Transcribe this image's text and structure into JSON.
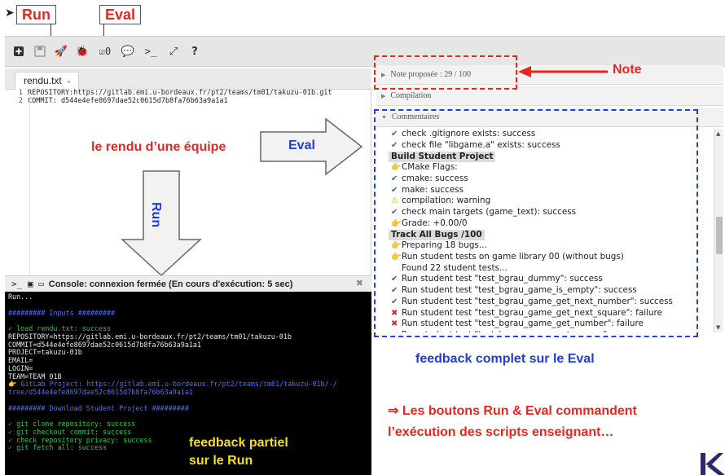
{
  "callouts": {
    "run": "Run",
    "eval": "Eval"
  },
  "toolbar": {
    "icons": [
      "new-file-icon",
      "save-icon",
      "run-rocket-icon",
      "bug-icon",
      "eval-checkbox-icon",
      "comment-icon",
      "terminal-icon",
      "fullscreen-icon",
      "help-icon"
    ],
    "eval_count": "0"
  },
  "editor": {
    "tab_label": "rendu.txt",
    "lines": [
      {
        "num": "1",
        "text": "REPOSITORY:https://gitlab.emi.u-bordeaux.fr/pt2/teams/tm01/takuzu-01b.git"
      },
      {
        "num": "2",
        "text": "COMMIT:  d544e4efe8697dae52c0615d7b8fa76b63a9a1a1"
      }
    ]
  },
  "annotations": {
    "team_render": "le rendu d’une équipe",
    "eval_arrow": "Eval",
    "run_arrow": "Run",
    "note": "Note",
    "feedback_full": "feedback complet sur le Eval",
    "buttons_line1": "⇒ Les boutons Run & Eval commandent",
    "buttons_line2": "l’exécution des scripts enseignant…",
    "feedback_partial_1": "feedback partiel",
    "feedback_partial_2": "sur le Run"
  },
  "panel": {
    "note_label": "Note proposée : 29 / 100",
    "compilation_label": "Compilation",
    "comments_label": "Commentaires",
    "comments": [
      {
        "icon": "check",
        "text": "check .gitignore exists: success"
      },
      {
        "icon": "check",
        "text": "check file \"libgame.a\" exists: success"
      },
      {
        "icon": "section",
        "text": "Build Student Project"
      },
      {
        "icon": "hand",
        "text": "CMake Flags:"
      },
      {
        "icon": "check",
        "text": "cmake: success"
      },
      {
        "icon": "check",
        "text": "make: success"
      },
      {
        "icon": "warn",
        "text": "compilation: warning"
      },
      {
        "icon": "check",
        "text": "check main targets (game_text): success"
      },
      {
        "icon": "hand",
        "text": "Grade: +0.00/0"
      },
      {
        "icon": "section",
        "text": "Track All Bugs /100"
      },
      {
        "icon": "hand",
        "text": "Preparing 18 bugs..."
      },
      {
        "icon": "hand",
        "text": "Run student tests on game library 00 (without bugs)"
      },
      {
        "icon": "none",
        "text": "Found 22 student tests..."
      },
      {
        "icon": "check",
        "text": "Run student test \"test_bgrau_dummy\": success"
      },
      {
        "icon": "check",
        "text": "Run student test \"test_bgrau_game_is_empty\": success"
      },
      {
        "icon": "check",
        "text": "Run student test \"test_bgrau_game_get_next_number\": success"
      },
      {
        "icon": "fail",
        "text": "Run student test \"test_bgrau_game_get_next_square\": failure"
      },
      {
        "icon": "fail",
        "text": "Run student test \"test_bgrau_game_get_number\": failure"
      },
      {
        "icon": "check",
        "text": "Run student test \"test_bgrau_game_get_square\": success"
      }
    ]
  },
  "console": {
    "title": "Console: connexion fermée (En cours d'exécution: 5 sec)",
    "lines": [
      {
        "c": "white",
        "t": "Run..."
      },
      {
        "c": "white",
        "t": ""
      },
      {
        "c": "blue",
        "t": "######### Inputs #########"
      },
      {
        "c": "white",
        "t": ""
      },
      {
        "c": "green",
        "t": "✓ load rendu.txt: success"
      },
      {
        "c": "white",
        "t": "REPOSITORY=https://gitlab.emi.u-bordeaux.fr/pt2/teams/tm01/takuzu-01b"
      },
      {
        "c": "white",
        "t": "COMMIT=d544e4efe8697dae52c0615d7b8fa76b63a9a1a1"
      },
      {
        "c": "white",
        "t": "PROJECT=takuzu-01b"
      },
      {
        "c": "white",
        "t": "EMAIL="
      },
      {
        "c": "white",
        "t": "LOGIN="
      },
      {
        "c": "white",
        "t": "TEAM=TEAM 01B"
      },
      {
        "c": "blue",
        "t": "👉 GitLab Project: https://gitlab.emi.u-bordeaux.fr/pt2/teams/tm01/takuzu-01b/-/"
      },
      {
        "c": "blue",
        "t": "tree/d544e4efe8697dae52c0615d7b8fa76b63a9a1a1"
      },
      {
        "c": "white",
        "t": ""
      },
      {
        "c": "blue",
        "t": "######### Download Student Project #########"
      },
      {
        "c": "white",
        "t": ""
      },
      {
        "c": "green",
        "t": "✓ git clone repository: success"
      },
      {
        "c": "green",
        "t": "✓ git checkout commit: success"
      },
      {
        "c": "green",
        "t": "✓ check repository privacy: success"
      },
      {
        "c": "green",
        "t": "✓ git fetch all: success"
      }
    ]
  },
  "colors": {
    "red": "#e4281f",
    "blue": "#2340d8",
    "yellow": "#f5df20"
  }
}
